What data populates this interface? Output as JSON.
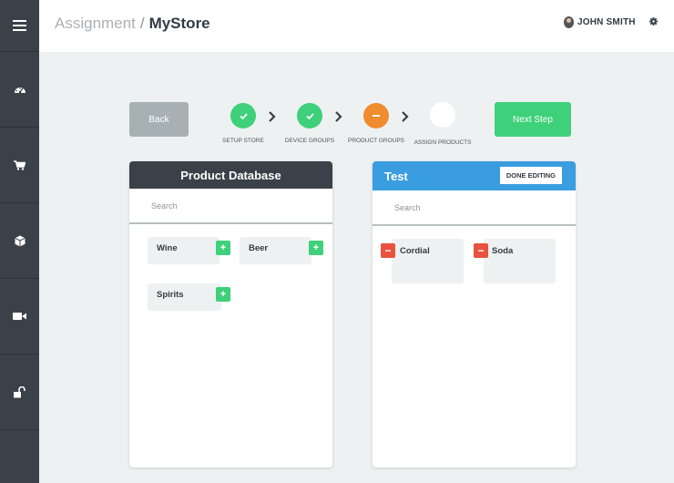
{
  "header": {
    "breadcrumb_parent": "Assignment",
    "breadcrumb_separator": "/",
    "breadcrumb_current": "MyStore",
    "user_name": "JOHN SMITH"
  },
  "sidebar": {
    "items": [
      {
        "icon": "menu-icon"
      },
      {
        "icon": "dashboard-icon"
      },
      {
        "icon": "cart-icon"
      },
      {
        "icon": "box-icon"
      },
      {
        "icon": "video-camera-icon"
      },
      {
        "icon": "unlock-icon"
      }
    ]
  },
  "stepper": {
    "back_label": "Back",
    "next_label": "Next Step",
    "steps": [
      {
        "label": "SETUP STORE",
        "state": "complete"
      },
      {
        "label": "DEVICE GROUPS",
        "state": "complete"
      },
      {
        "label": "PRODUCT GROUPS",
        "state": "in-progress"
      },
      {
        "label": "ASSIGN PRODUCTS",
        "state": "pending"
      }
    ]
  },
  "product_database": {
    "title": "Product Database",
    "search_placeholder": "Search",
    "items": [
      {
        "label": "Wine",
        "action": "+"
      },
      {
        "label": "Beer",
        "action": "+"
      },
      {
        "label": "Spirits",
        "action": "+"
      }
    ]
  },
  "group_panel": {
    "title": "Test",
    "done_label": "DONE EDITING",
    "search_placeholder": "Search",
    "items": [
      {
        "label": "Cordial",
        "action": "−"
      },
      {
        "label": "Soda",
        "action": "−"
      }
    ]
  },
  "colors": {
    "sidebar": "#3a4149",
    "success": "#3ed07a",
    "warning": "#ef8c2d",
    "danger": "#e8523f",
    "panel_dark": "#3a4149",
    "panel_blue": "#3a9de0",
    "neutral_button": "#a7b1b4"
  }
}
